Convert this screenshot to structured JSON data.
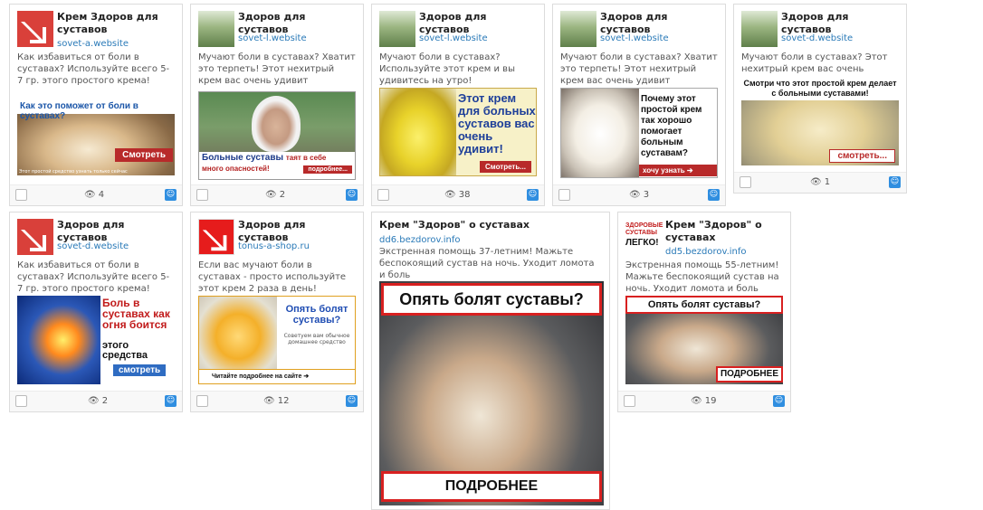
{
  "cards": [
    {
      "title": "Крем Здоров для суставов",
      "domain": "sovet-a.website",
      "desc": "Как избавиться от боли в суставах? Используйте всего 5-7 гр. этого простого крема!",
      "views": "4",
      "img": {
        "top": "Как это поможет от боли в суставах?",
        "button": "Смотреть",
        "small": "Этот простой средство узнать только сейчас"
      }
    },
    {
      "title": "Здоров для суставов",
      "domain": "sovet-l.website",
      "desc": "Мучают боли в суставах? Хватит это терпеть! Этот нехитрый крем вас очень удивит",
      "views": "2",
      "img": {
        "bottom_a": "Больные суставы",
        "bottom_b": "таят в себе",
        "bottom_c": "много опасностей!",
        "button": "подробнее..."
      }
    },
    {
      "title": "Здоров для суставов",
      "domain": "sovet-l.website",
      "desc": "Мучают боли в суставах? Используйте этот крем и вы удивитесь на утро!",
      "views": "38",
      "img": {
        "big": "Этот крем для больных суставов вас очень удивит!",
        "button": "Смотреть..."
      }
    },
    {
      "title": "Здоров для суставов",
      "domain": "sovet-l.website",
      "desc": "Мучают боли в суставах? Хватит это терпеть! Этот нехитрый крем вас очень удивит",
      "views": "3",
      "img": {
        "big": "Почему этот простой крем так хорошо помогает больным суставам?",
        "button": "хочу узнать"
      }
    },
    {
      "title": "Здоров для суставов",
      "domain": "sovet-d.website",
      "desc": "Мучают боли в суставах? Этот нехитрый крем вас очень удивит!",
      "views": "1",
      "img": {
        "top": "Смотри что этот простой крем делает с больными суставами!",
        "button": "смотреть..."
      }
    },
    {
      "title": "Здоров для суставов",
      "domain": "sovet-d.website",
      "desc": "Как избавиться от боли в суставах? Используйте всего 5-7 гр. этого простого крема!",
      "views": "2",
      "img": {
        "big_red": "Боль в суставах как огня боится",
        "big_black": "этого средства",
        "button": "смотреть"
      }
    },
    {
      "title": "Здоров для суставов",
      "domain": "tonus-a-shop.ru",
      "desc": "Если вас мучают боли в суставах - просто используйте этот крем 2 раза в день!",
      "views": "12",
      "img": {
        "blue": "Опять болят суставы?",
        "grey": "Советуем вам обычное домашнее средство",
        "bottom": "Читайте подробнее на сайте"
      }
    },
    {
      "title": "Крем \"Здоров\" о суставах",
      "domain": "dd6.bezdorov.info",
      "desc": "Экстренная помощь 37-летним! Мажьте беспокоящий сустав на ночь. Уходит ломота и боль",
      "views": "",
      "img": {
        "top": "Опять болят суставы?",
        "bottom": "ПОДРОБНЕЕ"
      }
    },
    {
      "title": "Крем \"Здоров\" о суставах",
      "domain": "dd5.bezdorov.info",
      "desc": "Экстренная помощь 55-летним! Мажьте беспокоящий сустав на ночь. Уходит ломота и боль",
      "views": "19",
      "icon_text": {
        "a": "ЗДОРОВЫЕ",
        "b": "СУСТАВЫ",
        "c": "ЛЕГКО!"
      },
      "img": {
        "top": "Опять болят суставы?",
        "bottom": "ПОДРОБНЕЕ"
      }
    }
  ]
}
